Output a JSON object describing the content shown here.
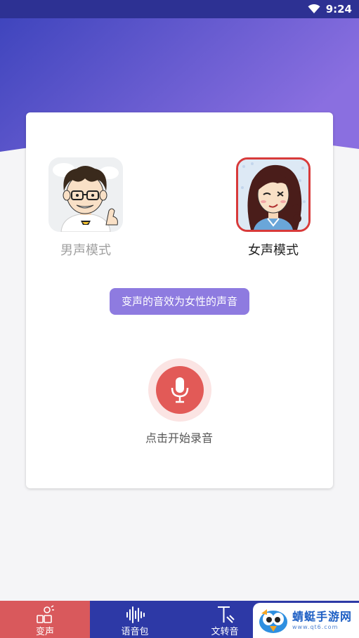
{
  "status_bar": {
    "time": "9:24",
    "wifi_icon": "wifi-icon"
  },
  "modes": {
    "male": {
      "label": "男声模式",
      "icon": "male-avatar"
    },
    "female": {
      "label": "女声模式",
      "icon": "female-avatar"
    }
  },
  "tip": "变声的音效为女性的声音",
  "record": {
    "label": "点击开始录音",
    "icon": "microphone-icon"
  },
  "nav": {
    "items": [
      {
        "label": "变声",
        "icon": "voice-change-icon",
        "active": true
      },
      {
        "label": "语音包",
        "icon": "waveform-icon",
        "active": false
      },
      {
        "label": "文转音",
        "icon": "text-to-speech-icon",
        "active": false
      }
    ]
  },
  "watermark": {
    "title": "蜻蜓手游网",
    "url": "www.qt6.com",
    "logo": "bird-logo"
  },
  "colors": {
    "header_gradient_start": "#3f45bd",
    "header_gradient_end": "#8a6fe0",
    "accent_red": "#e25a57",
    "tip_purple": "#8e7be0",
    "nav_blue": "#2d39a6"
  }
}
